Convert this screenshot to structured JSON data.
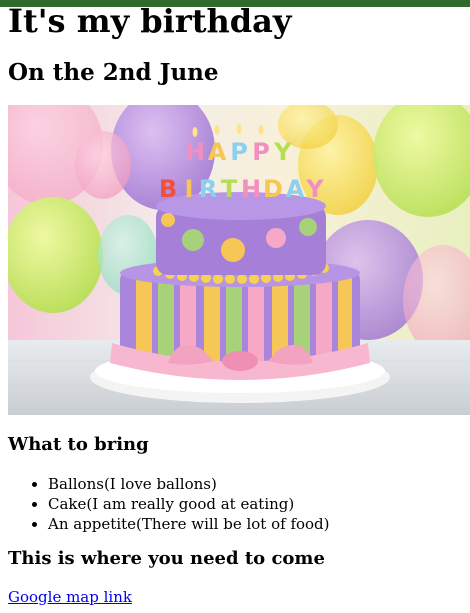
{
  "page": {
    "title": "It's my birthday",
    "subtitle": "On the 2nd June"
  },
  "hero_image": {
    "depicts": "cake-icon",
    "candle_letters_top": [
      "H",
      "A",
      "P",
      "P",
      "Y"
    ],
    "candle_letters_bottom": [
      "B",
      "I",
      "R",
      "T",
      "H",
      "D",
      "A",
      "Y"
    ]
  },
  "bring": {
    "heading": "What to bring",
    "items": [
      "Ballons(I love ballons)",
      "Cake(I am really good at eating)",
      "An appetite(There will be lot of food)"
    ]
  },
  "location": {
    "heading": "This is where you need to come",
    "link_text": "Google map link"
  },
  "colors": {
    "topbar": "#2f6a2a",
    "link": "#0000ee"
  }
}
